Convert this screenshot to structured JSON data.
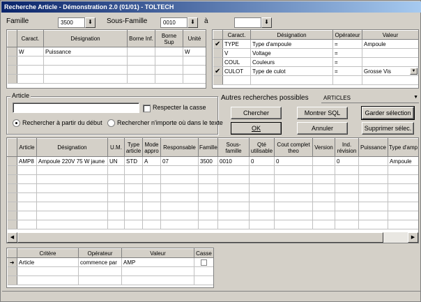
{
  "window": {
    "title": "Recherche Article - Démonstration 2.0 (01/01) - TOLTECH"
  },
  "filters": {
    "famille_label": "Famille",
    "famille_value": "3500",
    "sous_famille_label": "Sous-Famille",
    "sous_famille_value": "0010",
    "a_label": "à",
    "a_value": ""
  },
  "left_grid": {
    "headers": [
      "Caract.",
      "Désignation",
      "Borne Inf.",
      "Borne Sup",
      "Unité"
    ],
    "rows": [
      [
        "W",
        "Puissance",
        "",
        "",
        "W"
      ],
      [
        "",
        "",
        "",
        "",
        ""
      ],
      [
        "",
        "",
        "",
        "",
        ""
      ],
      [
        "",
        "",
        "",
        "",
        ""
      ]
    ]
  },
  "right_grid": {
    "headers": [
      "Caract.",
      "Désignation",
      "Opérateur",
      "Valeur"
    ],
    "rows": [
      {
        "check": "✔",
        "c": "TYPE",
        "d": "Type d'ampoule",
        "o": "=",
        "v": "Ampoule"
      },
      {
        "check": "",
        "c": "V",
        "d": "Voltage",
        "o": "=",
        "v": ""
      },
      {
        "check": "",
        "c": "COUL",
        "d": "Couleurs",
        "o": "=",
        "v": ""
      },
      {
        "check": "✔",
        "c": "CULOT",
        "d": "Type de culot",
        "o": "=",
        "v": "Grosse Vis"
      }
    ]
  },
  "article_group": {
    "title": "Article",
    "input_value": "",
    "respecter_casse": "Respecter la casse",
    "radio_debut": "Rechercher à partir du début",
    "radio_nimporte": "Rechercher n'importe où dans le texte"
  },
  "autres": {
    "label": "Autres recherches possibles",
    "value": "ARTICLES"
  },
  "buttons": {
    "chercher": "Chercher",
    "montrer_sql": "Montrer SQL",
    "garder": "Garder sélection",
    "ok": "OK",
    "annuler": "Annuler",
    "supprimer": "Supprimer sélec."
  },
  "results": {
    "headers": [
      "Article",
      "Désignation",
      "U.M.",
      "Type article",
      "Mode appro",
      "Responsable",
      "Famille",
      "Sous-famille",
      "Qté utilisable",
      "Cout complet theo",
      "Version",
      "Ind. révision",
      "Puissance",
      "Type d'amp"
    ],
    "rows": [
      [
        "AMP8",
        "Ampoule 220V 75 W jaune",
        "UN",
        "STD",
        "A",
        "07",
        "3500",
        "0010",
        "0",
        "0",
        "",
        "0",
        "",
        "Ampoule"
      ]
    ]
  },
  "criteria": {
    "headers": [
      "Critère",
      "Opérateur",
      "Valeur",
      "Casse"
    ],
    "rows": [
      {
        "pointer": "➜",
        "critere": "Article",
        "operateur": "commence par",
        "valeur": "AMP"
      }
    ]
  }
}
